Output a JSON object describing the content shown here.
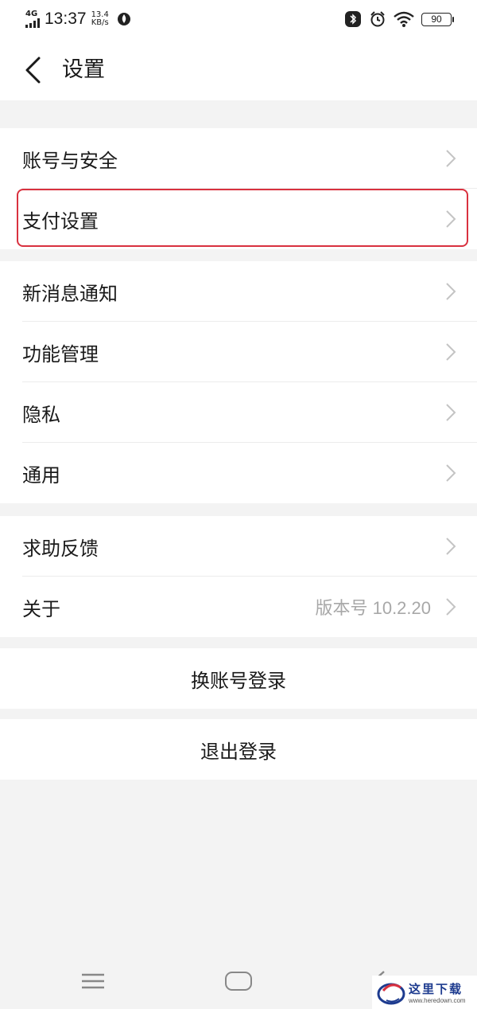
{
  "status_bar": {
    "network": "4G",
    "time": "13:37",
    "speed_value": "13.4",
    "speed_unit": "KB/s",
    "battery": "90"
  },
  "header": {
    "title": "设置"
  },
  "group1": [
    {
      "label": "账号与安全"
    },
    {
      "label": "支付设置"
    }
  ],
  "group2": [
    {
      "label": "新消息通知"
    },
    {
      "label": "功能管理"
    },
    {
      "label": "隐私"
    },
    {
      "label": "通用"
    }
  ],
  "group3": [
    {
      "label": "求助反馈"
    },
    {
      "label": "关于",
      "value": "版本号 10.2.20"
    }
  ],
  "actions": {
    "switch_account": "换账号登录",
    "logout": "退出登录"
  },
  "watermark": {
    "text": "这里下载",
    "url": "www.heredown.com"
  }
}
